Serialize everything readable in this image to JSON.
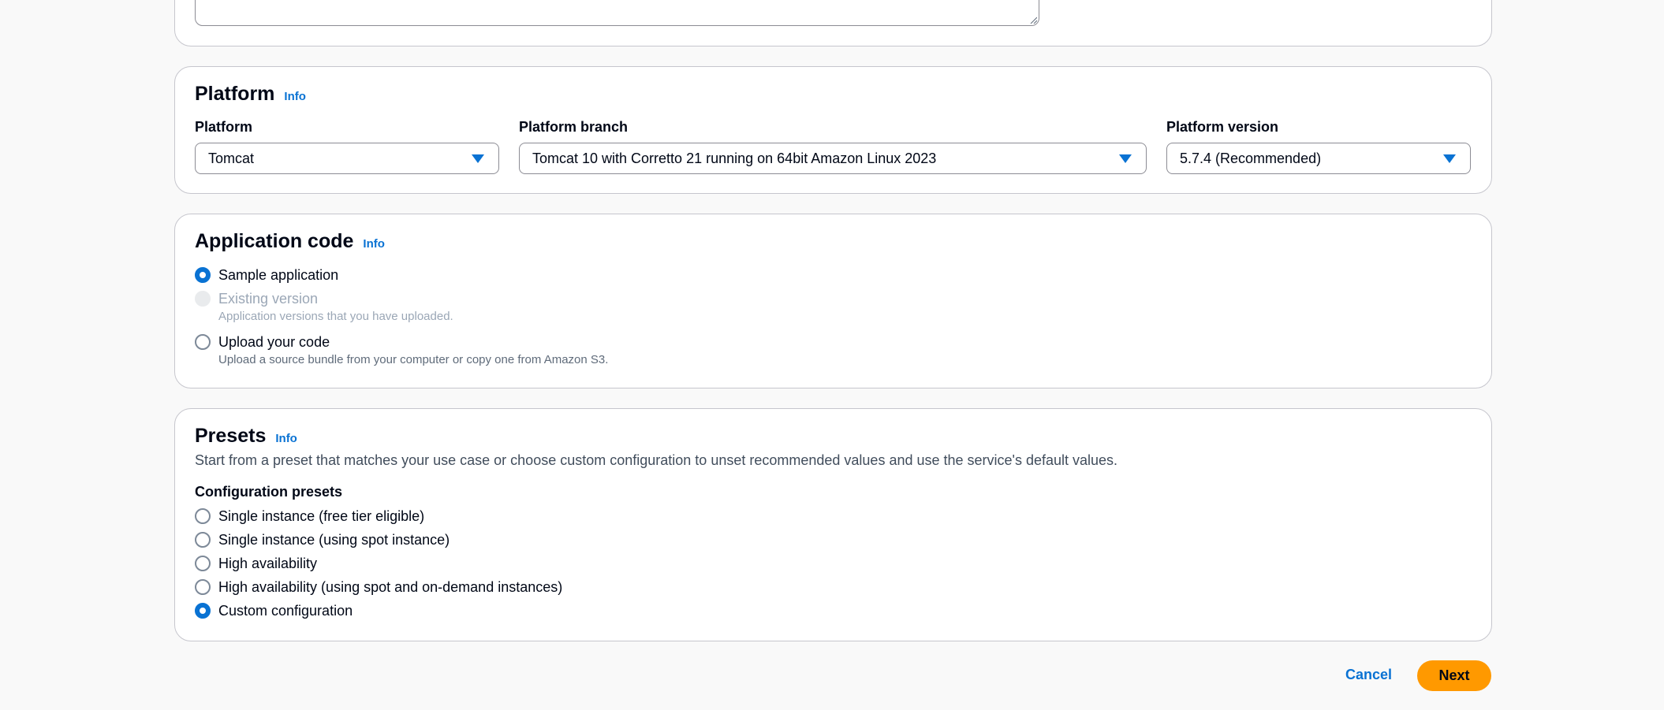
{
  "platform_section": {
    "heading": "Platform",
    "info": "Info",
    "platform": {
      "label": "Platform",
      "value": "Tomcat"
    },
    "branch": {
      "label": "Platform branch",
      "value": "Tomcat 10 with Corretto 21 running on 64bit Amazon Linux 2023"
    },
    "version": {
      "label": "Platform version",
      "value": "5.7.4 (Recommended)"
    }
  },
  "application_code": {
    "heading": "Application code",
    "info": "Info",
    "options": [
      {
        "label": "Sample application",
        "checked": true,
        "disabled": false,
        "description": ""
      },
      {
        "label": "Existing version",
        "checked": false,
        "disabled": true,
        "description": "Application versions that you have uploaded."
      },
      {
        "label": "Upload your code",
        "checked": false,
        "disabled": false,
        "description": "Upload a source bundle from your computer or copy one from Amazon S3."
      }
    ]
  },
  "presets": {
    "heading": "Presets",
    "info": "Info",
    "description": "Start from a preset that matches your use case or choose custom configuration to unset recommended values and use the service's default values.",
    "group_label": "Configuration presets",
    "options": [
      {
        "label": "Single instance (free tier eligible)",
        "checked": false
      },
      {
        "label": "Single instance (using spot instance)",
        "checked": false
      },
      {
        "label": "High availability",
        "checked": false
      },
      {
        "label": "High availability (using spot and on-demand instances)",
        "checked": false
      },
      {
        "label": "Custom configuration",
        "checked": true
      }
    ]
  },
  "actions": {
    "cancel": "Cancel",
    "next": "Next"
  },
  "colors": {
    "accent": "#0972d3",
    "primary_button": "#ff9900"
  }
}
